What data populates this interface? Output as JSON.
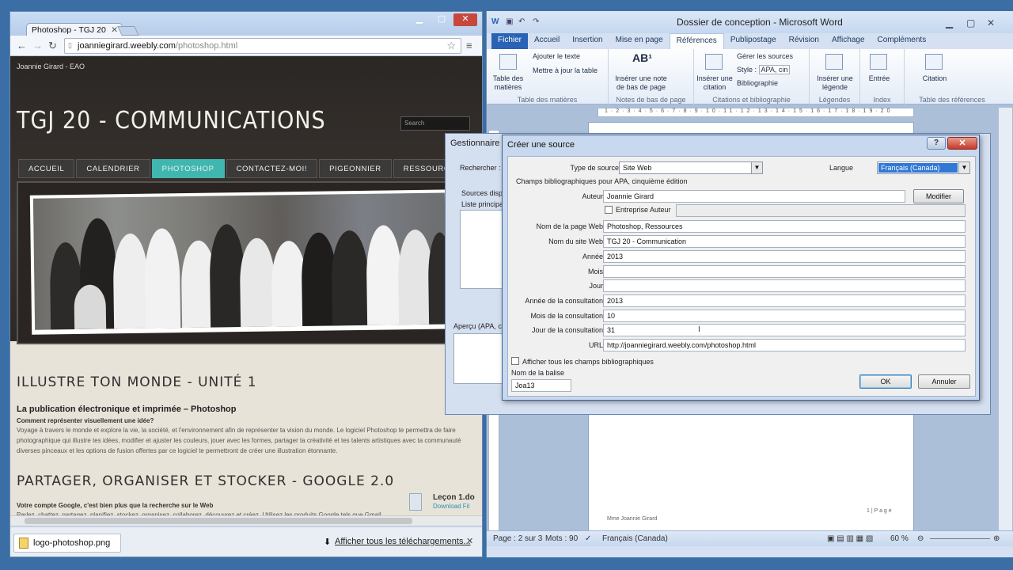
{
  "chrome": {
    "tab_title": "Photoshop - TGJ 20",
    "url_host": "joanniegirard.weebly.com",
    "url_path": "/photoshop.html",
    "site": {
      "brand": "Joannie Girard - EAO",
      "title": "TGJ 20 - COMMUNICATIONS",
      "search_placeholder": "Search",
      "nav": [
        "ACCUEIL",
        "CALENDRIER",
        "PHOTOSHOP",
        "CONTACTEZ-MOI!",
        "PIGEONNIER",
        "RESSOURCES"
      ],
      "section1": {
        "heading": "ILLUSTRE TON MONDE - UNITÉ 1",
        "subheading": "La publication électronique et imprimée – Photoshop",
        "question": "Comment représenter visuellement une idée?",
        "text": "Voyage à travers le monde et explore la vie, la société, et l'environnement afin de représenter ta vision du monde. Le logiciel Photoshop te permettra de faire photographique qui illustre tes idées, modifier et ajuster les couleurs, jouer avec les formes, partager ta créativité et tes talents artistiques avec ta communauté diverses pinceaux et les options de fusion offertes par ce logiciel te permettront de créer une illustration étonnante."
      },
      "section2": {
        "heading": "PARTAGER, ORGANISER ET STOCKER - GOOGLE 2.0",
        "question": "Votre compte Google, c'est bien plus que la recherche sur le Web",
        "text": "Parlez, chattez, partagez, planifiez, stockez, organisez, collaborez, découvrez et créez. Utilisez les produits Google tels que Gmail, Google+ ou encore YouTube, et consultez votre historique des recherches à l'aide d'un nom d'utilisateur et d'un mot de passe.",
        "download_title": "Leçon 1.do",
        "download_link": "Download Fil"
      }
    },
    "download_file": "logo-photoshop.png",
    "show_all_downloads": "Afficher tous les téléchargements..."
  },
  "word": {
    "title": "Dossier de conception - Microsoft Word",
    "tabs": [
      "Fichier",
      "Accueil",
      "Insertion",
      "Mise en page",
      "Références",
      "Publipostage",
      "Révision",
      "Affichage",
      "Compléments"
    ],
    "selected_tab": "Références",
    "ribbon": {
      "toc_btn": "Table des matières",
      "add_text": "Ajouter le texte",
      "update_table": "Mettre à jour la table",
      "grp_toc": "Table des matières",
      "insert_footnote": "Insérer une note de bas de page",
      "grp_footnotes": "Notes de bas de page",
      "insert_citation": "Insérer une citation",
      "manage_sources": "Gérer les sources",
      "style_label": "Style :",
      "style_value": "APA, cin",
      "bibliography": "Bibliographie",
      "grp_citations": "Citations et bibliographie",
      "insert_caption": "Insérer une légende",
      "grp_captions": "Légendes",
      "entry": "Entrée",
      "grp_index": "Index",
      "citation": "Citation",
      "grp_toa": "Table des références"
    },
    "footer_page": "1 | P a g e",
    "footer_author": "Mme Joannie Girard",
    "status": {
      "page": "Page : 2 sur 3",
      "words": "Mots : 90",
      "lang": "Français (Canada)",
      "zoom": "60 %"
    }
  },
  "manager": {
    "title": "Gestionnaire de",
    "search_label": "Rechercher :",
    "sources_available": "Sources dispo",
    "master_list": "Liste principal",
    "preview": "Aperçu (APA, ci"
  },
  "dialog": {
    "title": "Créer une source",
    "source_type_label": "Type de source",
    "source_type_value": "Site Web",
    "language_label": "Langue",
    "language_value": "Français (Canada)",
    "fields_caption": "Champs bibliographiques pour APA, cinquième édition",
    "author_label": "Auteur",
    "author_value": "Joannie Girard",
    "modify_button": "Modifier",
    "corporate_author": "Entreprise Auteur",
    "fields": [
      {
        "label": "Nom de la page Web",
        "value": "Photoshop, Ressources"
      },
      {
        "label": "Nom du site Web",
        "value": "TGJ 20 - Communication"
      },
      {
        "label": "Année",
        "value": "2013"
      },
      {
        "label": "Mois",
        "value": ""
      },
      {
        "label": "Jour",
        "value": ""
      },
      {
        "label": "Année de la consultation",
        "value": "2013"
      },
      {
        "label": "Mois de la consultation",
        "value": "10"
      },
      {
        "label": "Jour de la consultation",
        "value": "31"
      },
      {
        "label": "URL",
        "value": "http://joanniegirard.weebly.com/photoshop.html"
      }
    ],
    "show_all_fields": "Afficher tous les champs bibliographiques",
    "tag_label": "Nom de la balise",
    "tag_value": "Joa13",
    "ok": "OK",
    "cancel": "Annuler"
  }
}
